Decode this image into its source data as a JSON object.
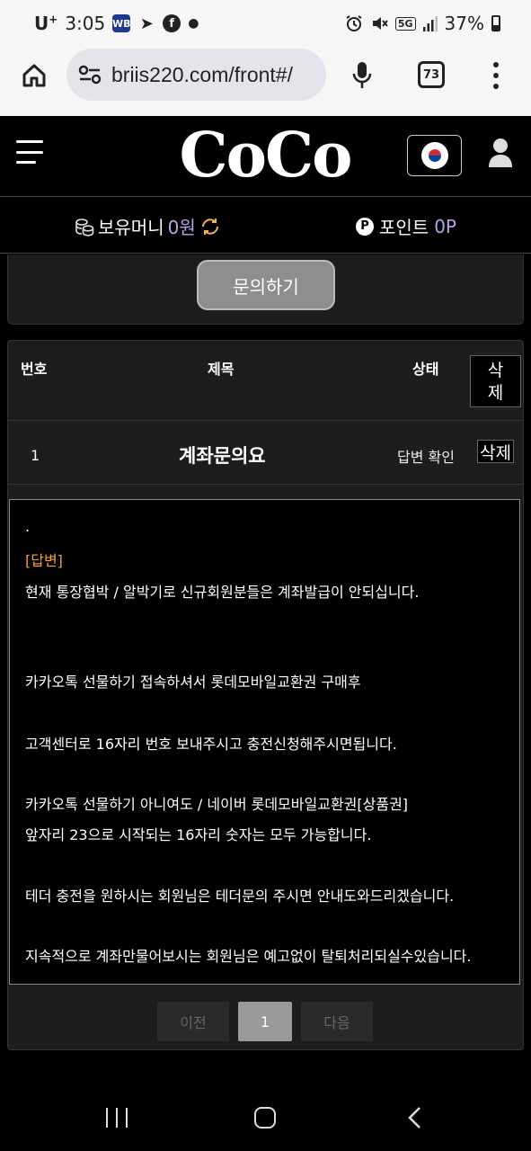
{
  "status_bar": {
    "carrier": "U",
    "carrier_sup": "+",
    "time": "3:05",
    "app_badge": "WB",
    "battery": "37%",
    "network": "5G"
  },
  "browser": {
    "url": "briis220.com/front#/",
    "tab_count": "73"
  },
  "header": {
    "logo": "CoCo"
  },
  "money_bar": {
    "money_label": "보유머니",
    "money_value": "0원",
    "point_icon": "P",
    "point_label": "포인트",
    "point_value": "0P"
  },
  "inquiry": {
    "button_label": "문의하기"
  },
  "table": {
    "headers": {
      "number": "번호",
      "title": "제목",
      "status": "상태",
      "delete": "삭제"
    },
    "rows": [
      {
        "number": "1",
        "title": "계좌문의요",
        "status": "답변 확인",
        "delete": "삭제"
      }
    ]
  },
  "answer": {
    "dot": ".",
    "tag": "[답변]",
    "lines": [
      "현재 통장협박 / 알박기로 신규회원분들은 계좌발급이 안되십니다.",
      "카카오톡 선물하기 접속하셔서 롯데모바일교환권 구매후",
      "고객센터로 16자리 번호 보내주시고 충전신청해주시면됩니다.",
      "카카오톡 선물하기 아니여도 / 네이버 롯데모바일교환권[상품권]",
      "앞자리 23으로 시작되는 16자리 숫자는 모두 가능합니다.",
      "테더 충전을 원하시는 회원님은 테더문의 주시면 안내도와드리겠습니다.",
      "지속적으로 계좌만물어보시는 회원님은 예고없이 탈퇴처리되실수있습니다."
    ]
  },
  "pagination": {
    "prev": "이전",
    "current": "1",
    "next": "다음"
  }
}
